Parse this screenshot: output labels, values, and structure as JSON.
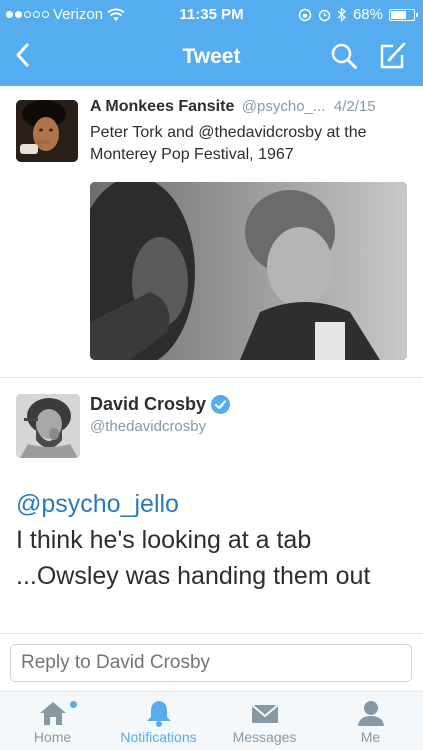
{
  "status_bar": {
    "carrier": "Verizon",
    "time": "11:35 PM",
    "battery": "68%",
    "battery_level": 0.68
  },
  "nav": {
    "title": "Tweet",
    "icons": [
      "chevron-left-icon",
      "search-icon",
      "compose-icon"
    ]
  },
  "quoted_tweet": {
    "name": "A Monkees Fansite",
    "handle": "@psycho_...",
    "date": "4/2/15",
    "text": "Peter Tork and @thedavidcrosby at the Monterey Pop Festival, 1967"
  },
  "main_tweet": {
    "name": "David Crosby",
    "handle": "@thedavidcrosby",
    "mention": "@psycho_jello",
    "text": "I think he's looking at a tab ...Owsley was handing them out"
  },
  "reply": {
    "placeholder": "Reply to David Crosby"
  },
  "tabs": [
    {
      "label": "Home",
      "icon": "home-icon"
    },
    {
      "label": "Notifications",
      "icon": "bell-icon"
    },
    {
      "label": "Messages",
      "icon": "envelope-icon"
    },
    {
      "label": "Me",
      "icon": "person-icon"
    }
  ],
  "colors": {
    "brand": "#55acee",
    "link": "#2b7bb9"
  }
}
